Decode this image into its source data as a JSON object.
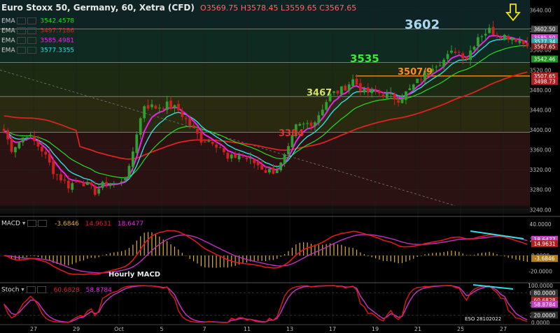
{
  "header": {
    "title": "Euro Stoxx 50, Germany, 60, Xetra (CFD)",
    "open": "3569.75",
    "high": "3578.45",
    "low": "3559.65",
    "close": "3567.65"
  },
  "ema_legend": [
    {
      "label": "EMA",
      "value": "3542.4578",
      "color": "#22dd22"
    },
    {
      "label": "EMA",
      "value": "3497.7186",
      "color": "#dd2222"
    },
    {
      "label": "EMA",
      "value": "3585.4981",
      "color": "#ee22ee"
    },
    {
      "label": "EMA",
      "value": "3577.3355",
      "color": "#33dddd"
    }
  ],
  "macd_legend": {
    "name": "MACD",
    "v1": "-3.6846",
    "v2": "14.9631",
    "v3": "18.6477"
  },
  "stoch_legend": {
    "name": "Stoch",
    "v1": "60.6828",
    "v2": "58.8784"
  },
  "annotations": {
    "level_3602": "3602",
    "level_3535": "3535",
    "level_3507": "3507/9",
    "level_3467": "3467",
    "level_3384": "3384",
    "hourly_macd": "Hourly MACD",
    "watermark": "ESO 28102022"
  },
  "colors": {
    "bull": "#2f9f2f",
    "bear": "#d02020",
    "ema_fast": "#ee22ee",
    "ema_mid": "#33dddd",
    "ema_slow": "#22dd22",
    "ema_200": "#dd2222",
    "arrow": "#f5e400",
    "orange_line": "#ff8c1a"
  },
  "chart_data": [
    {
      "type": "candlestick",
      "title": "Euro Stoxx 50, Germany, 60, Xetra (CFD)",
      "x_tick_labels": [
        "27",
        "29",
        "Oct",
        "5",
        "7",
        "11",
        "13",
        "17",
        "19",
        "21",
        "25",
        "27"
      ],
      "y_tick_labels": [
        3240,
        3280,
        3320,
        3360,
        3400,
        3440,
        3480,
        3520,
        3560,
        3600,
        3640
      ],
      "ylim": [
        3232,
        3652
      ],
      "price_path": [
        [
          0,
          3398
        ],
        [
          2,
          3362
        ],
        [
          6,
          3392
        ],
        [
          10,
          3360
        ],
        [
          13,
          3318
        ],
        [
          17,
          3288
        ],
        [
          20,
          3300
        ],
        [
          24,
          3276
        ],
        [
          27,
          3295
        ],
        [
          30,
          3290
        ],
        [
          33,
          3320
        ],
        [
          35,
          3395
        ],
        [
          37,
          3450
        ],
        [
          40,
          3445
        ],
        [
          43,
          3450
        ],
        [
          46,
          3440
        ],
        [
          49,
          3410
        ],
        [
          52,
          3380
        ],
        [
          55,
          3378
        ],
        [
          57,
          3365
        ],
        [
          59,
          3340
        ],
        [
          62,
          3350
        ],
        [
          64,
          3342
        ],
        [
          67,
          3330
        ],
        [
          69,
          3318
        ],
        [
          71,
          3318
        ],
        [
          73,
          3330
        ],
        [
          75,
          3360
        ],
        [
          77,
          3405
        ],
        [
          79,
          3410
        ],
        [
          82,
          3418
        ],
        [
          84,
          3445
        ],
        [
          86,
          3470
        ],
        [
          89,
          3480
        ],
        [
          92,
          3500
        ],
        [
          95,
          3475
        ],
        [
          98,
          3476
        ],
        [
          101,
          3470
        ],
        [
          104,
          3462
        ],
        [
          107,
          3480
        ],
        [
          110,
          3505
        ],
        [
          113,
          3530
        ],
        [
          116,
          3540
        ],
        [
          119,
          3560
        ],
        [
          122,
          3545
        ],
        [
          125,
          3588
        ],
        [
          128,
          3600
        ],
        [
          131,
          3590
        ],
        [
          134,
          3586
        ],
        [
          136,
          3580
        ],
        [
          138,
          3567
        ]
      ],
      "price_labels": [
        {
          "value": "3640.00",
          "price": 3640
        },
        {
          "value": "3602.50",
          "price": 3602
        },
        {
          "value": "3585.50",
          "price": 3585
        },
        {
          "value": "3577.34",
          "price": 3577
        },
        {
          "value": "3567.65",
          "price": 3567
        },
        {
          "value": "3542.46",
          "price": 3542
        },
        {
          "value": "3507.65",
          "price": 3508
        },
        {
          "value": "3498.73",
          "price": 3497
        }
      ],
      "horizontal_levels": [
        {
          "label": "3602",
          "price": 3602
        },
        {
          "label": "3535",
          "price": 3535
        },
        {
          "label": "3507/9",
          "price": 3508
        },
        {
          "label": "3467",
          "price": 3467
        },
        {
          "label": "3384",
          "price": 3395
        }
      ],
      "series": [
        {
          "name": "EMA",
          "last": 3585.4981,
          "color": "#ee22ee"
        },
        {
          "name": "EMA",
          "last": 3577.3355,
          "color": "#33dddd"
        },
        {
          "name": "EMA",
          "last": 3542.4578,
          "color": "#22dd22"
        },
        {
          "name": "EMA",
          "last": 3497.7186,
          "color": "#dd2222"
        }
      ]
    },
    {
      "type": "line",
      "title": "MACD",
      "y_tick_labels": [
        "40.0000",
        "20.0000",
        "0.0000",
        "-20.0000"
      ],
      "ylim": [
        -30,
        46
      ],
      "series": [
        {
          "name": "MACD",
          "last": 14.9631
        },
        {
          "name": "Signal",
          "last": 18.6477
        },
        {
          "name": "Histogram",
          "last": -3.6846
        }
      ],
      "price_labels": [
        "18.6477",
        "14.9631",
        "-3.6846"
      ]
    },
    {
      "type": "line",
      "title": "Stoch",
      "y_tick_labels": [
        "100.0000",
        "80.0000",
        "50.0000",
        "20.0000",
        "0.0000"
      ],
      "ylim": [
        0,
        100
      ],
      "series": [
        {
          "name": "%K",
          "last": 60.6828
        },
        {
          "name": "%D",
          "last": 58.8784
        }
      ],
      "price_labels": [
        "80.0000",
        "60.6828",
        "58.8784",
        "20.0000"
      ]
    }
  ]
}
